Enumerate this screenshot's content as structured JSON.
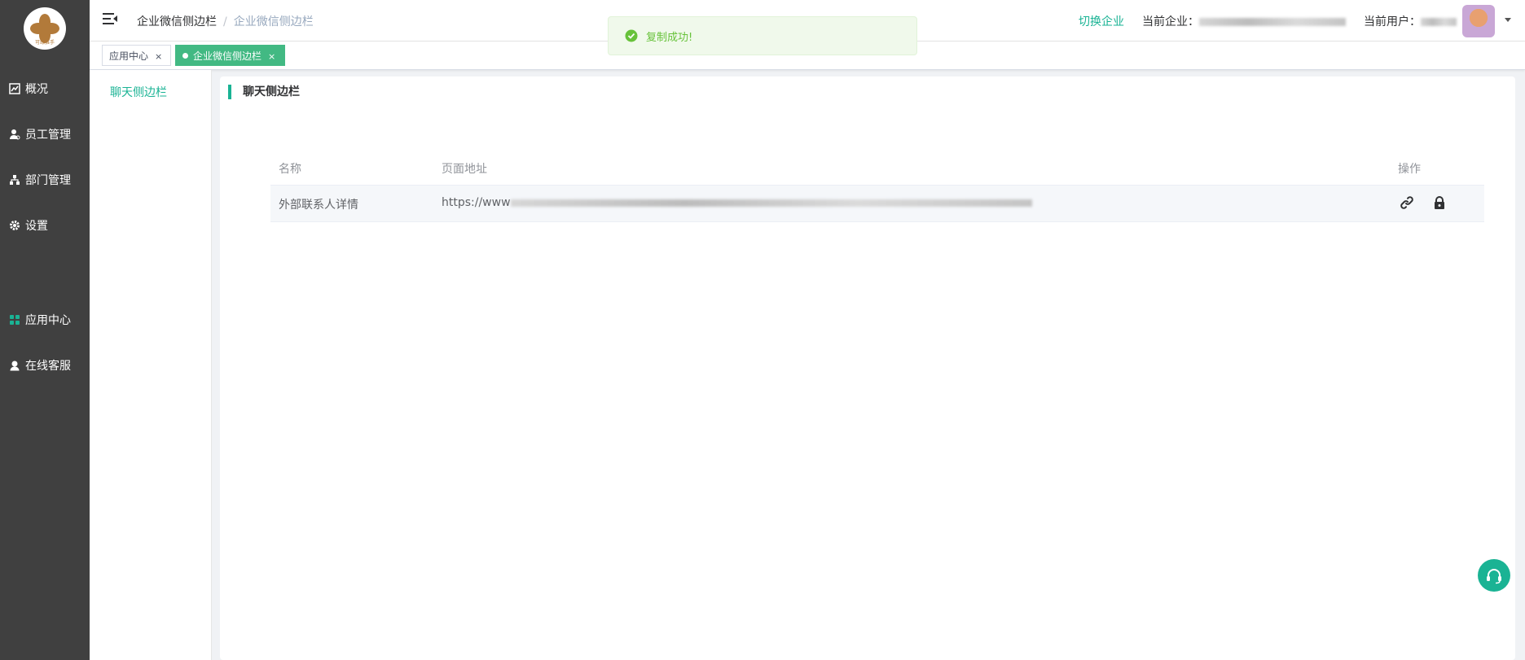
{
  "brand": {
    "logo_text": "可缘推手"
  },
  "sidebar": {
    "items": [
      {
        "label": "概况",
        "icon": "chart-icon"
      },
      {
        "label": "员工管理",
        "icon": "user-icon"
      },
      {
        "label": "部门管理",
        "icon": "org-icon"
      },
      {
        "label": "设置",
        "icon": "gear-icon"
      },
      {
        "label": "应用中心",
        "icon": "apps-icon"
      },
      {
        "label": "在线客服",
        "icon": "agent-icon"
      }
    ]
  },
  "header": {
    "breadcrumb": [
      "企业微信侧边栏",
      "企业微信侧边栏"
    ],
    "breadcrumb_sep": "/",
    "switch_enterprise": "切换企业",
    "current_enterprise_label": "当前企业：",
    "current_user_label": "当前用户："
  },
  "tabs": [
    {
      "label": "应用中心",
      "close": "×",
      "active": false
    },
    {
      "label": "企业微信侧边栏",
      "close": "×",
      "active": true
    }
  ],
  "submenu": {
    "items": [
      {
        "label": "聊天侧边栏",
        "active": true
      }
    ]
  },
  "main": {
    "title": "聊天侧边栏",
    "table": {
      "columns": [
        "名称",
        "页面地址",
        "操作"
      ],
      "rows": [
        {
          "name": "外部联系人详情",
          "url_prefix": "https://www"
        }
      ]
    }
  },
  "toast": {
    "type": "success",
    "message": "复制成功!"
  },
  "colors": {
    "accent": "#1ab394",
    "sidebar_bg": "#404040",
    "tag_active": "#42b983",
    "toast_text": "#67c23a"
  }
}
